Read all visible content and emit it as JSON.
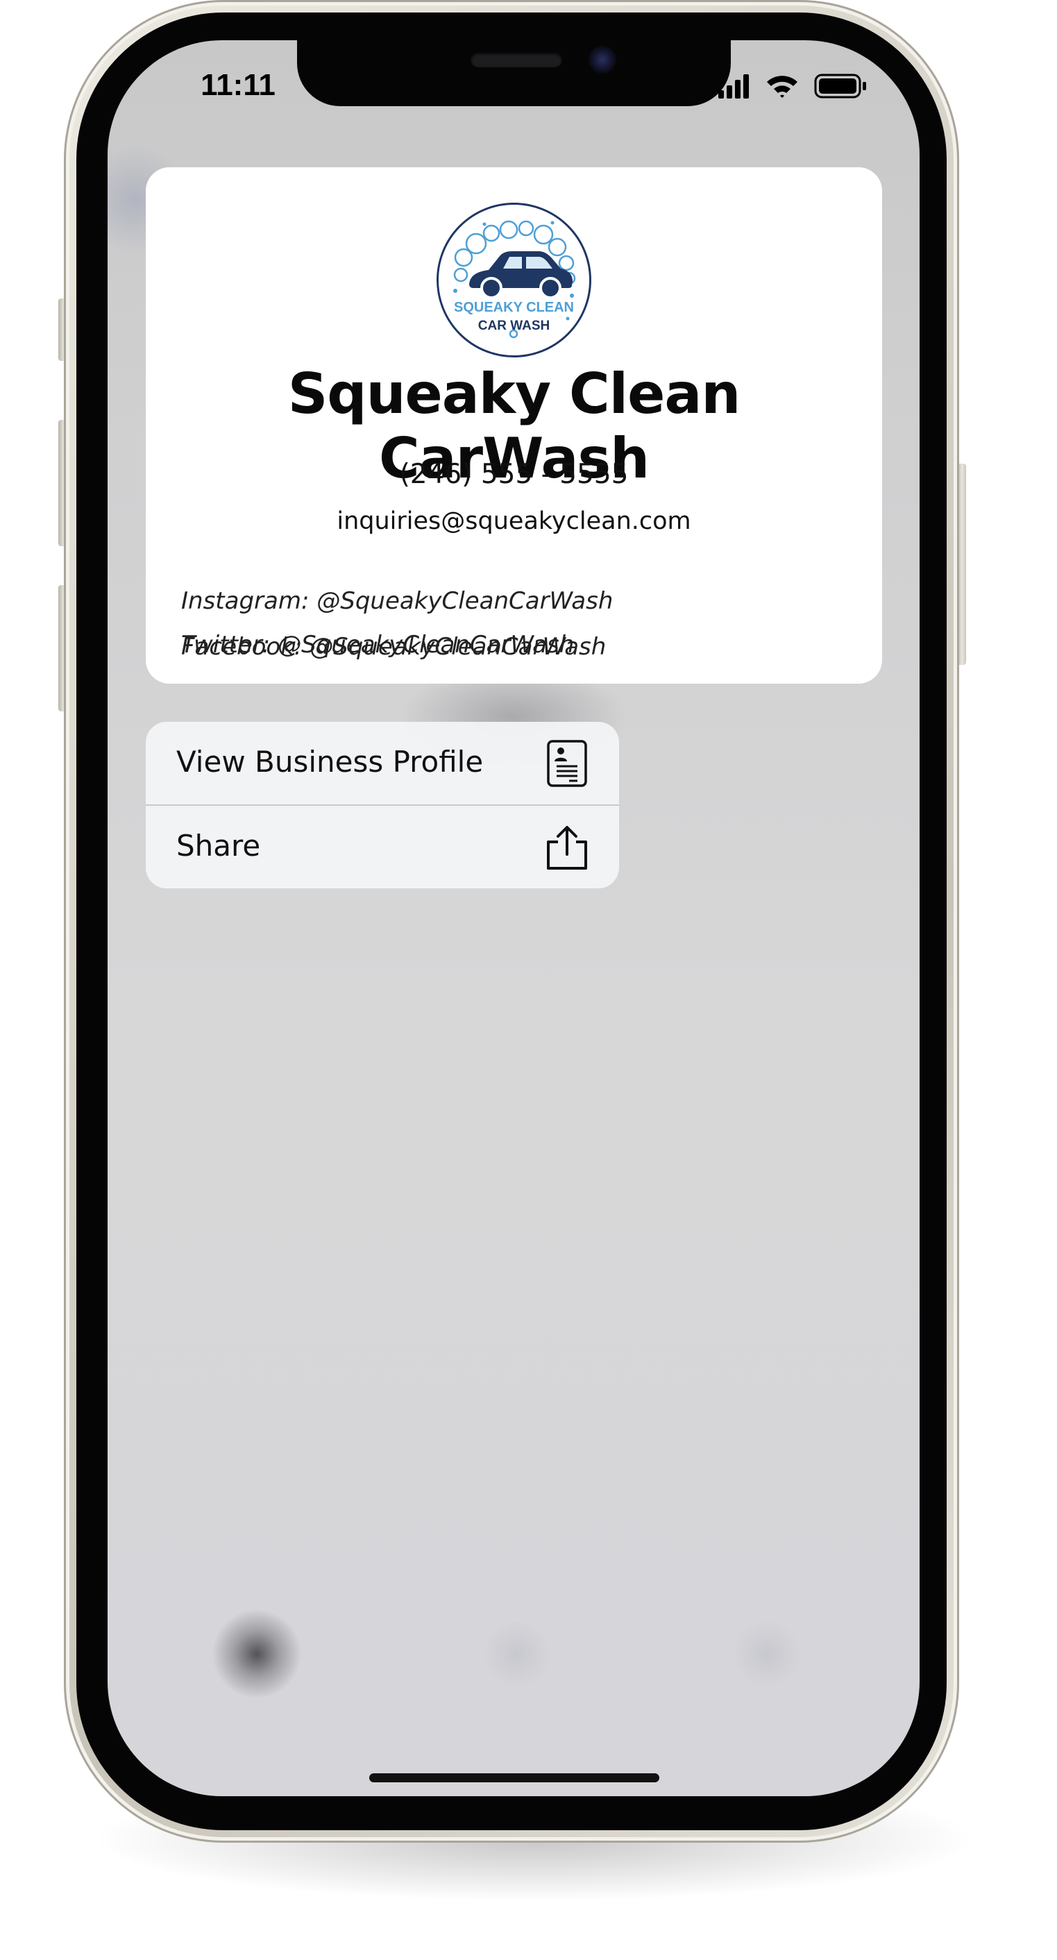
{
  "status_bar": {
    "time": "11:11",
    "icons": [
      "cellular-signal-icon",
      "wifi-icon",
      "battery-icon"
    ]
  },
  "business_card": {
    "logo": {
      "line1": "SQUEAKY CLEAN",
      "line2": "CAR WASH"
    },
    "name": "Squeaky Clean CarWash",
    "phone": "(246) 555 - 5555",
    "email": "inquiries@squeakyclean.com",
    "social": [
      "Instagram: @SqueakyCleanCarWash",
      "Twitter: @SqueakyCleanCarWash",
      "Facebook: @SqueakyCleanCarWash"
    ]
  },
  "context_menu": {
    "items": [
      {
        "label": "View Business Profile",
        "icon": "business-profile-icon"
      },
      {
        "label": "Share",
        "icon": "share-icon"
      }
    ]
  },
  "colors": {
    "logo_dark": "#1f3763",
    "logo_light": "#4e9fd6",
    "screen_background": "#d4d4d6",
    "frame": "#dcd8ce"
  }
}
